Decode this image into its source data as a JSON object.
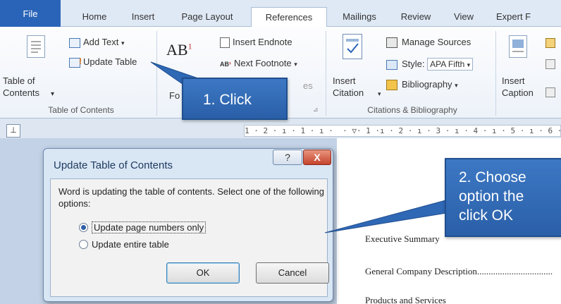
{
  "tabs": [
    "File",
    "Home",
    "Insert",
    "Page Layout",
    "References",
    "Mailings",
    "Review",
    "View",
    "Expert F"
  ],
  "active_tab": "References",
  "ribbon": {
    "toc": {
      "big_button_label": "Table of\nContents",
      "add_text": "Add Text",
      "update_table": "Update Table",
      "group_label": "Table of Contents"
    },
    "footnotes": {
      "insert_endnote": "Insert Endnote",
      "next_footnote": "Next Footnote",
      "ab_icon": "AB",
      "partial_label": "Fo",
      "partial_show": "es"
    },
    "citations": {
      "insert_citation": "Insert\nCitation",
      "manage_sources": "Manage Sources",
      "style_label": "Style:",
      "style_value": "APA Fifth",
      "bibliography": "Bibliography",
      "group_label": "Citations & Bibliography"
    },
    "captions": {
      "insert_caption": "Insert\nCaption"
    }
  },
  "ruler_text": "1 · 2 · ı · 1 · ı ·  · ▽· 1 ·ı · 2 · ı · 3 · ı · 4 · ı · 5 · ı · 6 · ı · 7",
  "ruler_corner": "⊥",
  "document": {
    "toc_lines": [
      "Executive Summary",
      "General Company Description.................................",
      "Products and Services"
    ]
  },
  "dialog": {
    "title": "Update Table of Contents",
    "help": "?",
    "close": "X",
    "message": "Word is updating the table of contents.  Select one of the following options:",
    "options": [
      "Update page numbers only",
      "Update entire table"
    ],
    "selected_option": 0,
    "ok": "OK",
    "cancel": "Cancel"
  },
  "callouts": {
    "step1": "1. Click",
    "step2_line1": "2. Choose",
    "step2_line2": "option the",
    "step2_line3": "click OK"
  },
  "colors": {
    "file_tab": "#2a64b8",
    "callout": "#2f68b5",
    "close_button": "#c5442c"
  }
}
